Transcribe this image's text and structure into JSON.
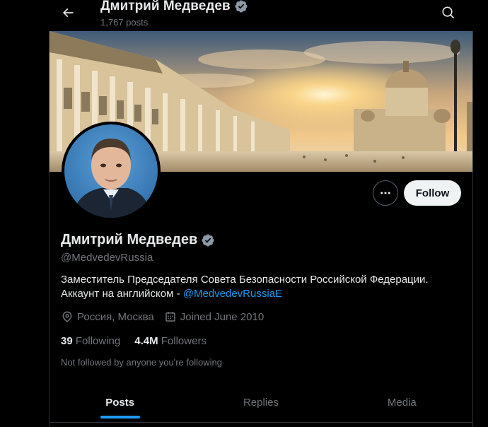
{
  "header": {
    "name": "Дмитрий Медведев",
    "posts_count": "1,767 posts"
  },
  "profile": {
    "name": "Дмитрий Медведев",
    "handle": "@MedvedevRussia",
    "bio_text": "Заместитель Председателя Совета Безопасности Российской Федерации. Аккаунт на английском - ",
    "bio_link": "@MedvedevRussiaE",
    "location": "Россия, Москва",
    "joined": "Joined June 2010",
    "following_count": "39",
    "following_label": "Following",
    "followers_count": "4.4M",
    "followers_label": "Followers",
    "not_followed": "Not followed by anyone you're following"
  },
  "actions": {
    "follow_label": "Follow"
  },
  "tabs": [
    {
      "label": "Posts",
      "active": true
    },
    {
      "label": "Replies",
      "active": false
    },
    {
      "label": "Media",
      "active": false
    }
  ],
  "colors": {
    "accent": "#1d9bf0",
    "verified_badge": "#8b98a5",
    "background": "#000000"
  },
  "icons": {
    "back": "arrow-left-icon",
    "search": "search-icon",
    "verified": "verified-badge-icon",
    "more": "more-horizontal-icon",
    "location": "location-pin-icon",
    "calendar": "calendar-icon"
  }
}
